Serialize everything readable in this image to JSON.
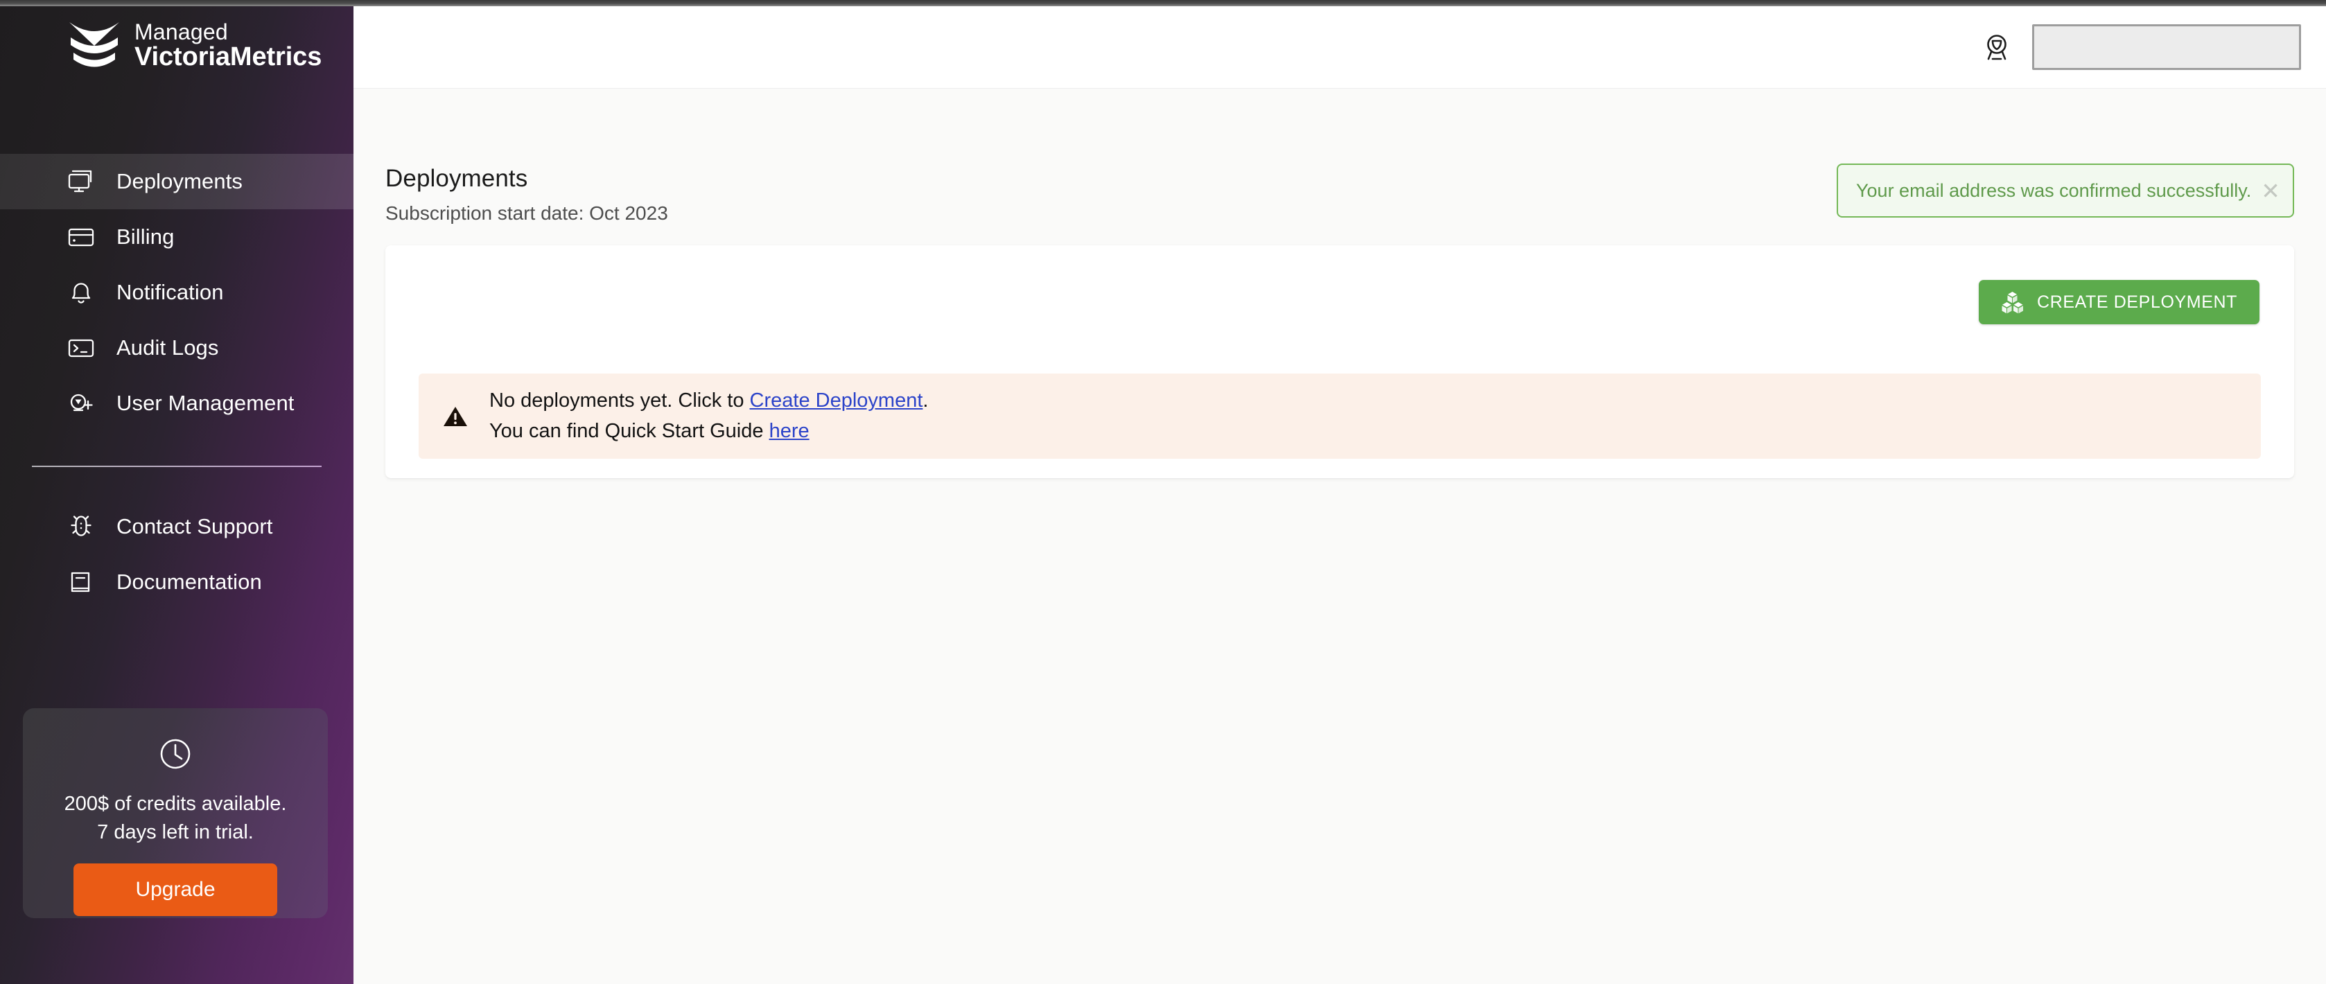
{
  "brand": {
    "line1": "Managed",
    "line2": "VictoriaMetrics",
    "logo_icon": "chevron-stack-logo"
  },
  "sidebar": {
    "primary_items": [
      {
        "label": "Deployments",
        "icon": "monitors-icon",
        "active": true
      },
      {
        "label": "Billing",
        "icon": "credit-card-icon",
        "active": false
      },
      {
        "label": "Notification",
        "icon": "bell-icon",
        "active": false
      },
      {
        "label": "Audit Logs",
        "icon": "terminal-icon",
        "active": false
      },
      {
        "label": "User Management",
        "icon": "user-add-icon",
        "active": false
      }
    ],
    "secondary_items": [
      {
        "label": "Contact Support",
        "icon": "bug-icon"
      },
      {
        "label": "Documentation",
        "icon": "book-icon"
      }
    ],
    "trial_card": {
      "icon": "clock-icon",
      "credits_line": "200$ of credits available.",
      "days_line": "7 days left in trial.",
      "upgrade_label": "Upgrade",
      "upgrade_color": "#ea5b15"
    }
  },
  "topbar": {
    "badge_icon": "award-badge-icon",
    "input_value": "",
    "input_placeholder": ""
  },
  "main": {
    "page_title": "Deployments",
    "page_subtitle": "Subscription start date: Oct 2023",
    "toast": {
      "message": "Your email address was confirmed successfully.",
      "close_icon": "close-icon",
      "accent_color": "#74b857",
      "background_color": "#f2f9ef"
    },
    "card": {
      "create_button": {
        "label": "CREATE DEPLOYMENT",
        "icon": "cubes-icon",
        "color": "#5cab4c"
      },
      "alert": {
        "icon": "warning-triangle-icon",
        "background_color": "#fcf0e8",
        "line1_prefix": "No deployments yet. Click to ",
        "line1_link": "Create Deployment",
        "line1_suffix": ".",
        "line2_prefix": "You can find Quick Start Guide ",
        "line2_link": "here",
        "link_color": "#2b43c9"
      }
    }
  }
}
